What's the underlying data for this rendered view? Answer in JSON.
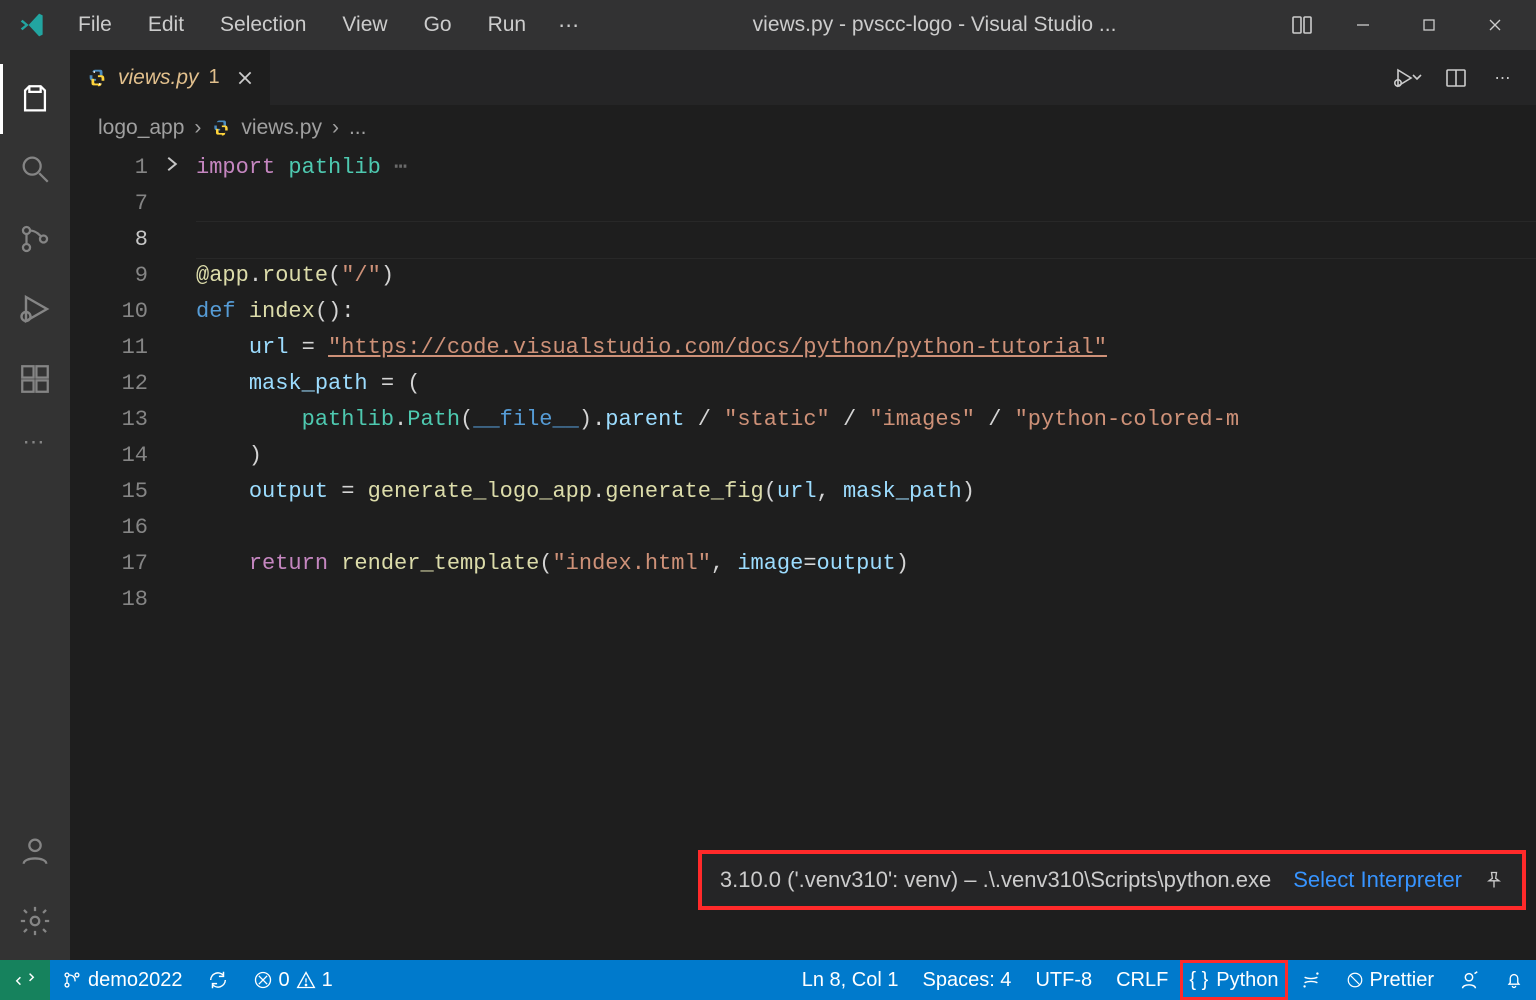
{
  "titlebar": {
    "menus": [
      "File",
      "Edit",
      "Selection",
      "View",
      "Go",
      "Run"
    ],
    "overflow": "⋯",
    "title": "views.py - pvscc-logo - Visual Studio ..."
  },
  "tabs": {
    "active": {
      "filename": "views.py",
      "dirty_marker": "1"
    }
  },
  "actions": {
    "run_debug": "run",
    "split": "split",
    "more": "more"
  },
  "breadcrumb": [
    "logo_app",
    "views.py",
    "..."
  ],
  "editor": {
    "line_numbers": [
      "1",
      "7",
      "8",
      "9",
      "10",
      "11",
      "12",
      "13",
      "14",
      "15",
      "16",
      "17",
      "18"
    ],
    "fold_line": 0,
    "lines": [
      {
        "tokens": [
          [
            "kw",
            "import"
          ],
          [
            "par",
            " "
          ],
          [
            "cls",
            "pathlib"
          ],
          [
            "par",
            " "
          ],
          [
            "comment",
            "⋯"
          ]
        ],
        "folded": true
      },
      {
        "tokens": [
          [
            "par",
            ""
          ]
        ]
      },
      {
        "tokens": [
          [
            "par",
            ""
          ]
        ],
        "current": true
      },
      {
        "tokens": [
          [
            "dec",
            "@app"
          ],
          [
            "op",
            "."
          ],
          [
            "fn",
            "route"
          ],
          [
            "par",
            "("
          ],
          [
            "str",
            "\"/\""
          ],
          [
            "par",
            ")"
          ]
        ]
      },
      {
        "tokens": [
          [
            "kwdef",
            "def"
          ],
          [
            "par",
            " "
          ],
          [
            "fn",
            "index"
          ],
          [
            "par",
            "():"
          ]
        ]
      },
      {
        "tokens": [
          [
            "par",
            "    "
          ],
          [
            "var",
            "url"
          ],
          [
            "par",
            " "
          ],
          [
            "op",
            "="
          ],
          [
            "par",
            " "
          ],
          [
            "str-link",
            "\"https://code.visualstudio.com/docs/python/python-tutorial\""
          ]
        ]
      },
      {
        "tokens": [
          [
            "par",
            "    "
          ],
          [
            "var",
            "mask_path"
          ],
          [
            "par",
            " "
          ],
          [
            "op",
            "="
          ],
          [
            "par",
            " ("
          ]
        ]
      },
      {
        "tokens": [
          [
            "par",
            "        "
          ],
          [
            "cls",
            "pathlib"
          ],
          [
            "op",
            "."
          ],
          [
            "cls",
            "Path"
          ],
          [
            "par",
            "("
          ],
          [
            "const",
            "__file__"
          ],
          [
            "par",
            ")"
          ],
          [
            "op",
            "."
          ],
          [
            "var",
            "parent"
          ],
          [
            "par",
            " "
          ],
          [
            "op",
            "/"
          ],
          [
            "par",
            " "
          ],
          [
            "str",
            "\"static\""
          ],
          [
            "par",
            " "
          ],
          [
            "op",
            "/"
          ],
          [
            "par",
            " "
          ],
          [
            "str",
            "\"images\""
          ],
          [
            "par",
            " "
          ],
          [
            "op",
            "/"
          ],
          [
            "par",
            " "
          ],
          [
            "str",
            "\"python-colored-m"
          ]
        ]
      },
      {
        "tokens": [
          [
            "par",
            "    )"
          ]
        ]
      },
      {
        "tokens": [
          [
            "par",
            "    "
          ],
          [
            "var",
            "output"
          ],
          [
            "par",
            " "
          ],
          [
            "op",
            "="
          ],
          [
            "par",
            " "
          ],
          [
            "fn",
            "generate_logo_app"
          ],
          [
            "op",
            "."
          ],
          [
            "fn",
            "generate_fig"
          ],
          [
            "par",
            "("
          ],
          [
            "var",
            "url"
          ],
          [
            "par",
            ", "
          ],
          [
            "var",
            "mask_path"
          ],
          [
            "par",
            ")"
          ]
        ]
      },
      {
        "tokens": [
          [
            "par",
            ""
          ]
        ]
      },
      {
        "tokens": [
          [
            "par",
            "    "
          ],
          [
            "kw",
            "return"
          ],
          [
            "par",
            " "
          ],
          [
            "fn",
            "render_template"
          ],
          [
            "par",
            "("
          ],
          [
            "str",
            "\"index.html\""
          ],
          [
            "par",
            ", "
          ],
          [
            "var",
            "image"
          ],
          [
            "op",
            "="
          ],
          [
            "var",
            "output"
          ],
          [
            "par",
            ")"
          ]
        ]
      },
      {
        "tokens": [
          [
            "par",
            ""
          ]
        ]
      }
    ]
  },
  "interpreter_tip": {
    "text": "3.10.0 ('.venv310': venv) – .\\.venv310\\Scripts\\python.exe",
    "link": "Select Interpreter"
  },
  "statusbar": {
    "remote_icon": "remote",
    "branch": "demo2022",
    "sync": "sync",
    "errors": "0",
    "warnings": "1",
    "cursor": "Ln 8, Col 1",
    "spaces": "Spaces: 4",
    "encoding": "UTF-8",
    "eol": "CRLF",
    "bracket": "{ }",
    "language": "Python",
    "jupyter": "jupyter",
    "prettier": "Prettier",
    "feedback": "feedback",
    "bell": "bell"
  }
}
